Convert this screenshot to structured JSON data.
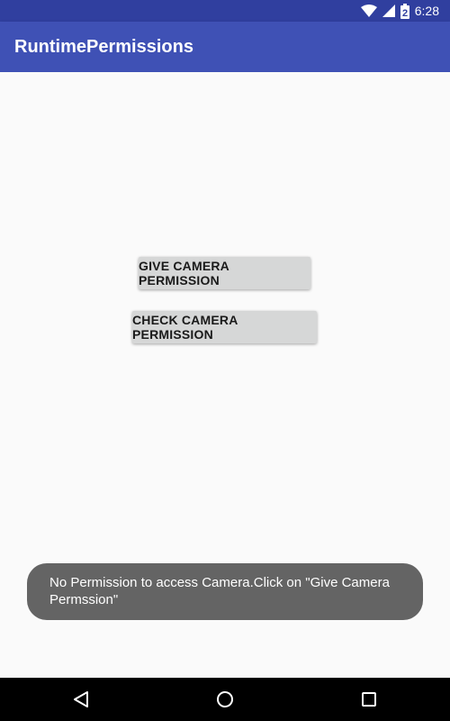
{
  "status_bar": {
    "time": "6:28",
    "icons": [
      "wifi-icon",
      "signal-icon",
      "battery-icon"
    ],
    "battery_label": "2"
  },
  "app_bar": {
    "title": "RuntimePermissions"
  },
  "main": {
    "give_button_label": "GIVE CAMERA PERMISSION",
    "check_button_label": "CHECK CAMERA PERMISSION"
  },
  "toast": {
    "message": "No Permission to access Camera.Click on \"Give Camera Permssion\""
  },
  "nav_bar": {
    "icons": [
      "back-icon",
      "home-icon",
      "recents-icon"
    ]
  },
  "colors": {
    "status_bar": "#303f9f",
    "app_bar": "#3f51b5",
    "background": "#fafafa",
    "button": "#d6d7d7",
    "toast": "#646464",
    "nav_bar": "#000000"
  }
}
